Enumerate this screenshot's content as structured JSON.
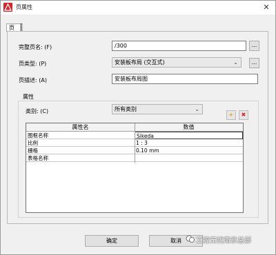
{
  "window": {
    "title": "页属性",
    "close_glyph": "✕"
  },
  "tabs": [
    {
      "label": "页"
    }
  ],
  "form": {
    "full_name": {
      "label": "完整页名: (F)",
      "value": "/300"
    },
    "page_type": {
      "label": "页类型: (P)",
      "value": "安装板布局 (交互式)"
    },
    "description": {
      "label": "页描述: (A)",
      "value": "安装板布局图"
    },
    "browse_label": "..."
  },
  "properties": {
    "group_title": "属性",
    "category": {
      "label": "类别: (C)",
      "value": "所有类别"
    },
    "add_glyph": "+",
    "delete_glyph": "✖",
    "table": {
      "columns": [
        "属性名",
        "数值"
      ],
      "rows": [
        {
          "name": "图框名称",
          "value": "Sikeda"
        },
        {
          "name": "比例",
          "value": "1 : 3"
        },
        {
          "name": "栅格",
          "value": "0.10 mm"
        },
        {
          "name": "表格名称",
          "value": ""
        }
      ]
    }
  },
  "footer": {
    "ok_label": "确定",
    "cancel_label": "取消",
    "watermark": "工控无忧南京总部"
  },
  "colors": {
    "accent_red": "#d7262a",
    "dialog_bg": "#f0f0f0"
  }
}
